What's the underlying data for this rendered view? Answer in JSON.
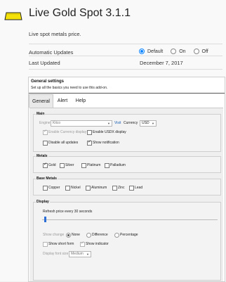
{
  "addon": {
    "title": "Live Gold Spot 3.1.1",
    "description": "Live spot metals price."
  },
  "rows": {
    "auto_updates_label": "Automatic Updates",
    "auto_updates_options": [
      "Default",
      "On",
      "Off"
    ],
    "auto_updates_selected": "Default",
    "last_updated_label": "Last Updated",
    "last_updated_value": "December 7, 2017"
  },
  "settings": {
    "title": "General settings",
    "subtitle": "Set up all the basics you need to use this add-on.",
    "tabs": [
      "General",
      "Alert",
      "Help"
    ],
    "active_tab": "General",
    "main": {
      "legend": "Main",
      "engine_label": "Engine",
      "engine_value": "Kitco",
      "visit_link": "Visit",
      "currency_label": "Currency",
      "currency_value": "USD",
      "enable_currency": "Enable Currency display",
      "enable_usdx": "Enable USDX display",
      "disable_updates": "Disable all updates",
      "show_notification": "Show notification"
    },
    "metals": {
      "legend": "Metals",
      "items": [
        "Gold",
        "Silver",
        "Platinum",
        "Palladium"
      ]
    },
    "base_metals": {
      "legend": "Base Metals",
      "items": [
        "Copper",
        "Nickel",
        "Aluminum",
        "Zinc",
        "Lead"
      ]
    },
    "display": {
      "legend": "Display",
      "refresh_label": "Refresh price every 30 seconds",
      "show_change_label": "Show change",
      "change_options": [
        "None",
        "Difference",
        "Percentage"
      ],
      "change_selected": "None",
      "show_short_form": "Show short form",
      "show_indicator": "Show indicator",
      "font_size_label": "Display font size",
      "font_size_value": "Medium"
    }
  },
  "colors": {
    "logo": "#f4e10a",
    "accent": "#0a84ff"
  }
}
